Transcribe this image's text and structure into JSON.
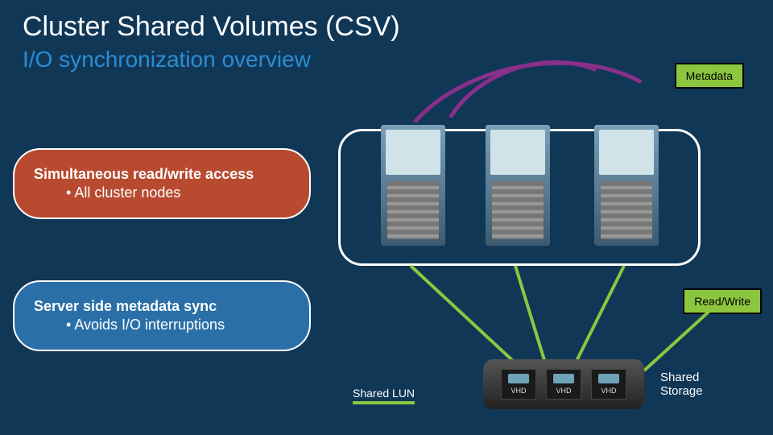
{
  "title": "Cluster Shared Volumes  (CSV)",
  "subtitle": "I/O synchronization overview",
  "badges": {
    "metadata": "Metadata",
    "readwrite": "Read/Write"
  },
  "callouts": {
    "red": {
      "heading": "Simultaneous read/write access",
      "bullet": "All cluster nodes"
    },
    "blue": {
      "heading": "Server side metadata sync",
      "bullet": "Avoids I/O interruptions"
    }
  },
  "labels": {
    "shared_lun": "Shared LUN",
    "shared_storage": "Shared\nStorage",
    "vhd": "VHD"
  },
  "diagram": {
    "server_count": 3,
    "vhd_count": 3
  }
}
